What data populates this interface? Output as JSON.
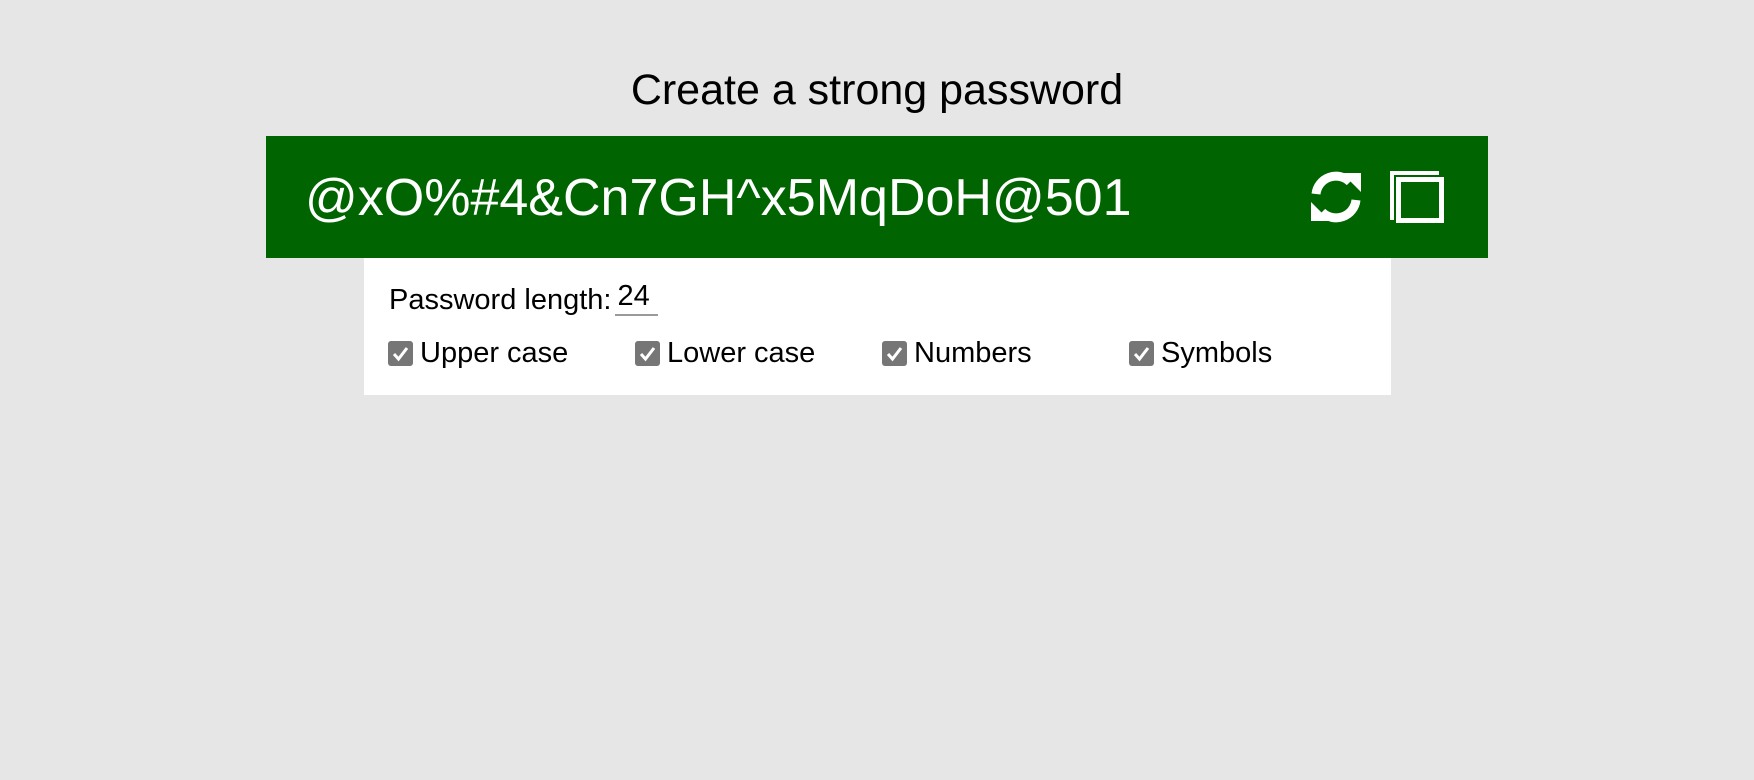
{
  "header": {
    "title": "Create a strong password"
  },
  "generator": {
    "password": "@xO%#4&Cn7GH^x5MqDoH@501",
    "bar_color": "#006400",
    "refresh_icon": "refresh-icon",
    "copy_icon": "copy-icon"
  },
  "options": {
    "length_label": "Password length:",
    "length_value": "24",
    "checkboxes": [
      {
        "label": "Upper case",
        "checked": true
      },
      {
        "label": "Lower case",
        "checked": true
      },
      {
        "label": "Numbers",
        "checked": true
      },
      {
        "label": "Symbols",
        "checked": true
      }
    ]
  }
}
